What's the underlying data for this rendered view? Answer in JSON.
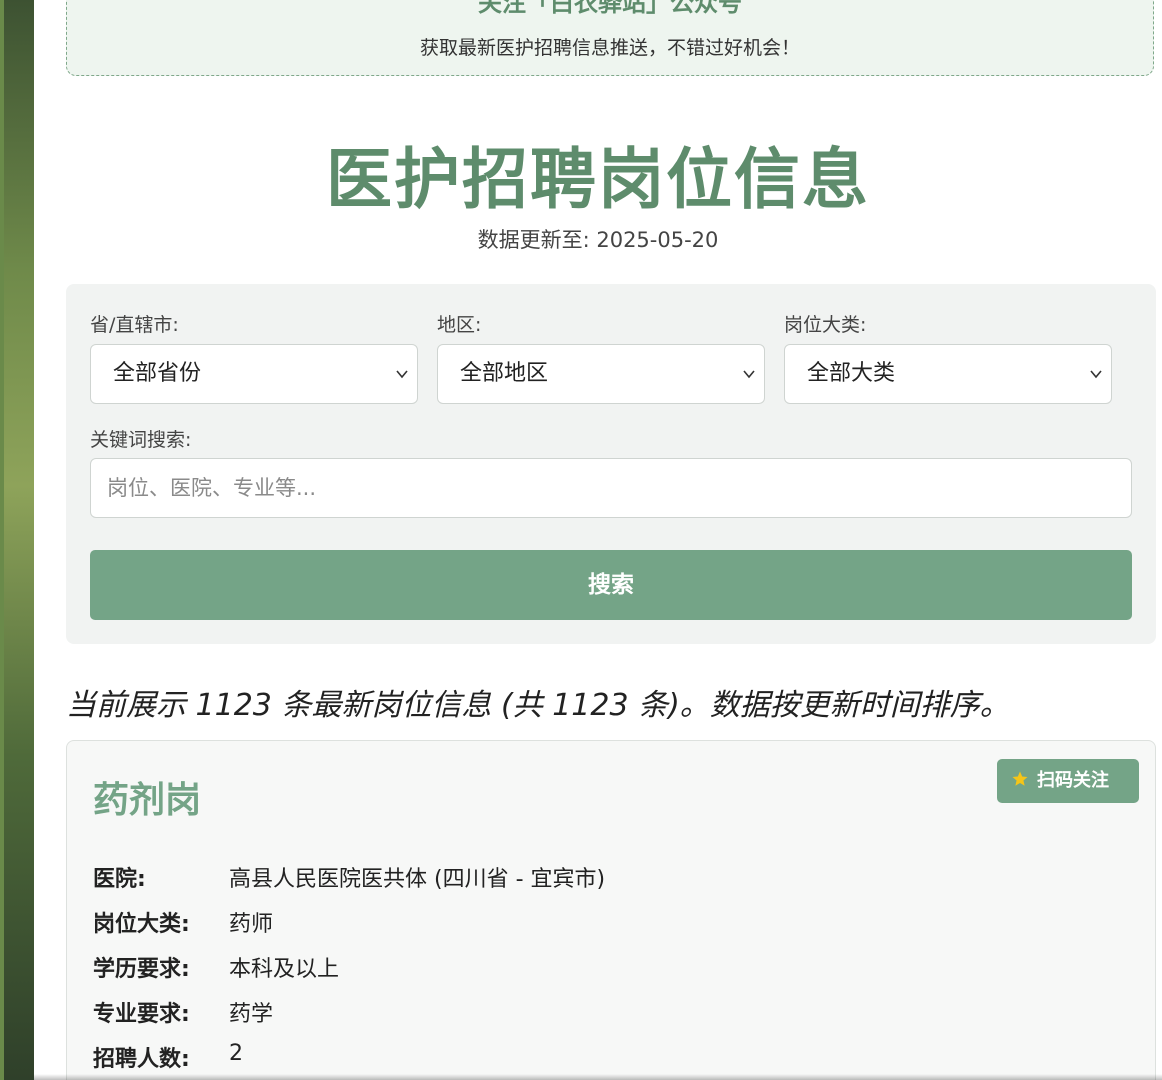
{
  "banner": {
    "title": "关注「白衣驿站」公众号",
    "text": "获取最新医护招聘信息推送，不错过好机会！"
  },
  "header": {
    "title": "医护招聘岗位信息",
    "update": "数据更新至: 2025-05-20"
  },
  "filters": {
    "province_label": "省/直辖市:",
    "province_value": "全部省份",
    "region_label": "地区:",
    "region_value": "全部地区",
    "category_label": "岗位大类:",
    "category_value": "全部大类",
    "keyword_label": "关键词搜索:",
    "keyword_placeholder": "岗位、医院、专业等...",
    "search_label": "搜索"
  },
  "summary": "当前展示 1123 条最新岗位信息 (共 1123 条)。数据按更新时间排序。",
  "job": {
    "title": "药剂岗",
    "follow_label": "扫码关注",
    "fields": [
      {
        "key": "医院:",
        "value": "高县人民医院医共体 (四川省 - 宜宾市)"
      },
      {
        "key": "岗位大类:",
        "value": "药师"
      },
      {
        "key": "学历要求:",
        "value": "本科及以上"
      },
      {
        "key": "专业要求:",
        "value": "药学"
      },
      {
        "key": "招聘人数:",
        "value": "2"
      }
    ]
  },
  "colors": {
    "accent": "#74a487",
    "title": "#5e8c6c"
  }
}
